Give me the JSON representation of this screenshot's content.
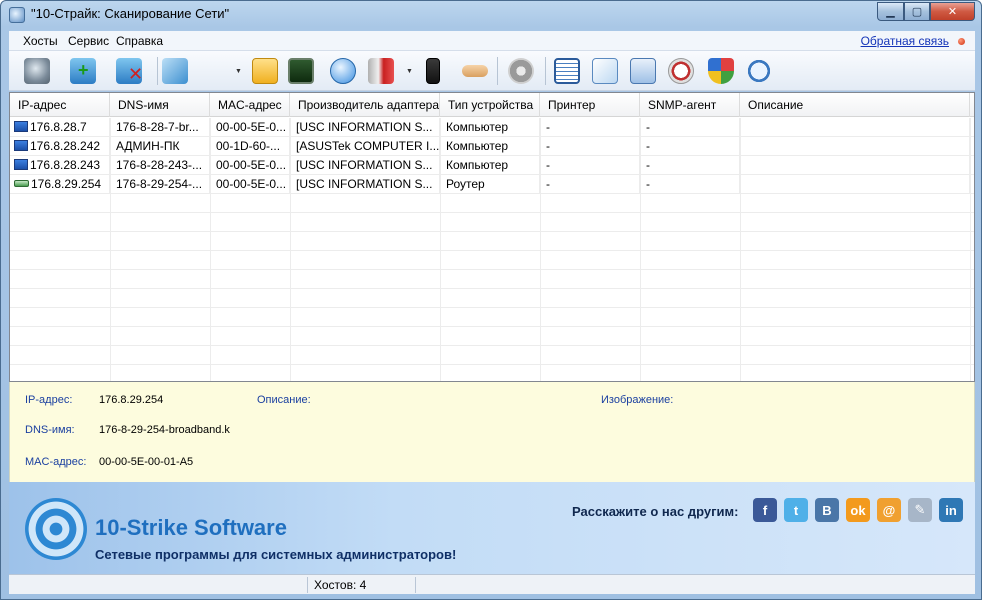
{
  "window": {
    "title": "\"10-Страйк: Сканирование Сети\""
  },
  "menu": {
    "items": [
      "Хосты",
      "Сервис",
      "Справка"
    ],
    "feedback": "Обратная связь"
  },
  "toolbar": {
    "buttons": [
      "scan-icon",
      "add-host-icon",
      "delete-host-icon",
      "network-icon",
      "folder-icon",
      "monitor-icon",
      "go-icon",
      "tools-icon",
      "phone-icon",
      "handshake-icon",
      "settings-icon",
      "report-icon",
      "map-icon",
      "graph-icon",
      "speed-icon",
      "shield-icon",
      "search-icon"
    ]
  },
  "grid": {
    "columns": [
      "IP-адрес",
      "DNS-имя",
      "MAC-адрес",
      "Производитель адаптера",
      "Тип устройства",
      "Принтер",
      "SNMP-агент",
      "Описание"
    ],
    "rows": [
      {
        "type": "host",
        "ip": "176.8.28.7",
        "dns": "176-8-28-7-br...",
        "mac": "00-00-5E-0...",
        "vendor": "[USC INFORMATION S...",
        "device": "Компьютер",
        "printer": "-",
        "snmp": "-",
        "desc": ""
      },
      {
        "type": "host",
        "ip": "176.8.28.242",
        "dns": "АДМИН-ПК",
        "mac": "00-1D-60-...",
        "vendor": "[ASUSTek COMPUTER I...",
        "device": "Компьютер",
        "printer": "-",
        "snmp": "-",
        "desc": ""
      },
      {
        "type": "host",
        "ip": "176.8.28.243",
        "dns": "176-8-28-243-...",
        "mac": "00-00-5E-0...",
        "vendor": "[USC INFORMATION S...",
        "device": "Компьютер",
        "printer": "-",
        "snmp": "-",
        "desc": ""
      },
      {
        "type": "router",
        "ip": "176.8.29.254",
        "dns": "176-8-29-254-...",
        "mac": "00-00-5E-0...",
        "vendor": "[USC INFORMATION S...",
        "device": "Роутер",
        "printer": "-",
        "snmp": "-",
        "desc": ""
      }
    ]
  },
  "details": {
    "ip_label": "IP-адрес:",
    "ip_value": "176.8.29.254",
    "dns_label": "DNS-имя:",
    "dns_value": "176-8-29-254-broadband.k",
    "mac_label": "MAC-адрес:",
    "mac_value": "00-00-5E-00-01-A5",
    "desc_label": "Описание:",
    "image_label": "Изображение:"
  },
  "banner": {
    "brand": "10-Strike Software",
    "tagline": "Сетевые программы для системных администраторов!",
    "share": "Расскажите о нас другим:",
    "social": [
      {
        "icon": "facebook-icon",
        "glyph": "f",
        "color": "#3b5998"
      },
      {
        "icon": "twitter-icon",
        "glyph": "t",
        "color": "#4fb0e8"
      },
      {
        "icon": "vkontakte-icon",
        "glyph": "B",
        "color": "#4a76a8"
      },
      {
        "icon": "odnoklassniki-icon",
        "glyph": "ok",
        "color": "#f39a1d"
      },
      {
        "icon": "mail-icon",
        "glyph": "@",
        "color": "#f0a030"
      },
      {
        "icon": "livejournal-icon",
        "glyph": "✎",
        "color": "#a7b6c8"
      },
      {
        "icon": "linkedin-icon",
        "glyph": "in",
        "color": "#2f78b5"
      }
    ]
  },
  "status": {
    "hosts": "Хостов: 4"
  }
}
